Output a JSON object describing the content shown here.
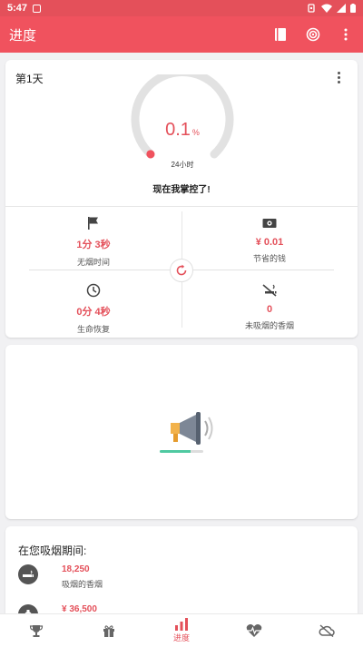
{
  "status_bar": {
    "time": "5:47"
  },
  "app_bar": {
    "title": "进度",
    "icons": [
      "book-icon",
      "target-icon",
      "more-vert-icon"
    ]
  },
  "progress_card": {
    "day_label": "第1天",
    "gauge": {
      "percent": 0.1,
      "percent_text": "0.1",
      "unit": "%",
      "sub_label": "24小时"
    },
    "status_message": "现在我掌控了!",
    "stats": [
      {
        "icon": "flag-icon",
        "value": "1分 3秒",
        "label": "无烟时间"
      },
      {
        "icon": "money-icon",
        "value": "¥ 0.01",
        "label": "节省的钱"
      },
      {
        "icon": "clock-icon",
        "value": "0分 4秒",
        "label": "生命恢复"
      },
      {
        "icon": "no-smoking-icon",
        "value": "0",
        "label": "未吸烟的香烟"
      }
    ]
  },
  "ad_card": {
    "icon": "megaphone-icon",
    "loading_fraction": 0.7
  },
  "during_card": {
    "title": "在您吸烟期间:",
    "rows": [
      {
        "icon": "cigarette-icon",
        "value": "18,250",
        "label": "吸烟的香烟"
      },
      {
        "icon": "money-bag-icon",
        "value": "¥ 36,500",
        "label": ""
      }
    ]
  },
  "bottom_nav": {
    "items": [
      {
        "icon": "trophy-icon",
        "label": ""
      },
      {
        "icon": "gift-icon",
        "label": ""
      },
      {
        "icon": "bar-chart-icon",
        "label": "进度",
        "active": true
      },
      {
        "icon": "heart-pulse-icon",
        "label": ""
      },
      {
        "icon": "cloud-off-icon",
        "label": ""
      }
    ]
  },
  "colors": {
    "accent": "#f0525e",
    "accent_text": "#e4505a",
    "gauge_track": "#e2e2e2",
    "progress_fill": "#4fc9a1"
  }
}
